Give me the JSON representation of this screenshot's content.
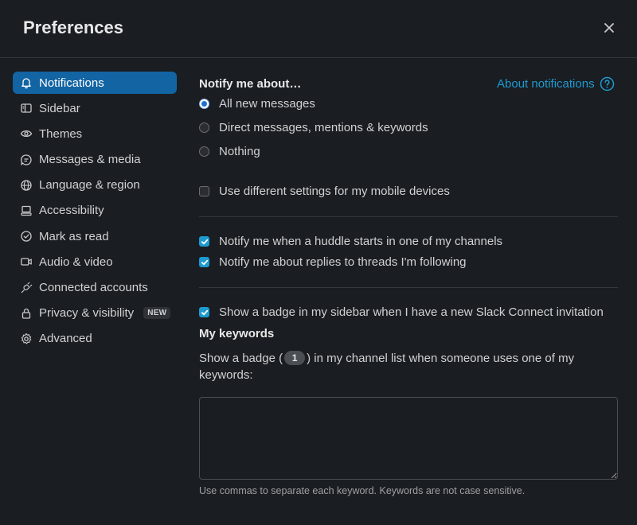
{
  "window": {
    "title": "Preferences"
  },
  "sidebar": {
    "items": [
      {
        "label": "Notifications",
        "icon": "bell-icon",
        "active": true
      },
      {
        "label": "Sidebar",
        "icon": "sidebar-icon"
      },
      {
        "label": "Themes",
        "icon": "eye-icon"
      },
      {
        "label": "Messages & media",
        "icon": "message-icon"
      },
      {
        "label": "Language & region",
        "icon": "globe-icon"
      },
      {
        "label": "Accessibility",
        "icon": "keyboard-icon"
      },
      {
        "label": "Mark as read",
        "icon": "check-circle-icon"
      },
      {
        "label": "Audio & video",
        "icon": "video-icon"
      },
      {
        "label": "Connected accounts",
        "icon": "plug-icon"
      },
      {
        "label": "Privacy & visibility",
        "icon": "lock-icon",
        "badge": "NEW"
      },
      {
        "label": "Advanced",
        "icon": "gear-icon"
      }
    ]
  },
  "main": {
    "notify_heading": "Notify me about…",
    "about_link": "About notifications",
    "radios": [
      {
        "label": "All new messages",
        "selected": true
      },
      {
        "label": "Direct messages, mentions & keywords",
        "selected": false
      },
      {
        "label": "Nothing",
        "selected": false
      }
    ],
    "mobile_checkbox": {
      "label": "Use different settings for my mobile devices",
      "checked": false
    },
    "huddle_checkbox": {
      "label": "Notify me when a huddle starts in one of my channels",
      "checked": true
    },
    "threads_checkbox": {
      "label": "Notify me about replies to threads I'm following",
      "checked": true
    },
    "badge_checkbox": {
      "label": "Show a badge in my sidebar when I have a new Slack Connect invitation",
      "checked": true
    },
    "keywords": {
      "heading": "My keywords",
      "label_before": "Show a badge (",
      "badge_count": "1",
      "label_after": ") in my channel list when someone uses one of my keywords:",
      "value": "",
      "hint": "Use commas to separate each keyword. Keywords are not case sensitive."
    }
  },
  "colors": {
    "background": "#1a1d21",
    "accent": "#1264a3",
    "link": "#1d9bd1",
    "divider": "#35373b"
  }
}
